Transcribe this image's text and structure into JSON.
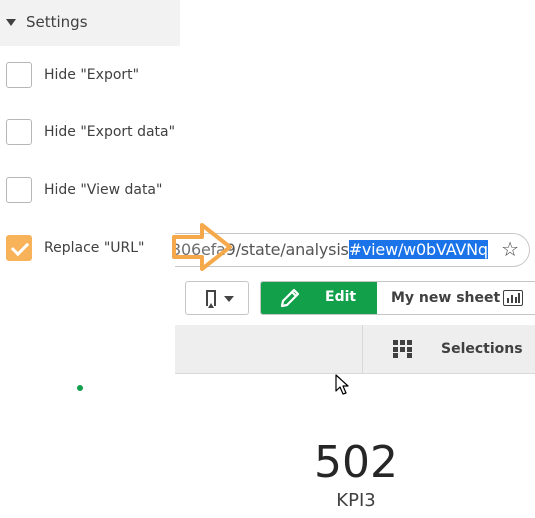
{
  "settings": {
    "title": "Settings",
    "options": [
      {
        "label": "Hide \"Export\"",
        "checked": false
      },
      {
        "label": "Hide \"Export data\"",
        "checked": false
      },
      {
        "label": "Hide \"View data\"",
        "checked": false
      },
      {
        "label": "Replace \"URL\"",
        "checked": true
      }
    ],
    "accent_color": "#f8b25a"
  },
  "address_bar": {
    "url_prefix": "306efa9/state/analysis",
    "url_selected": "#view/w0bVAVNq",
    "selection_color": "#1a73e8",
    "annotation_color": "#f6a94a"
  },
  "toolbar": {
    "edit_label": "Edit",
    "sheet_name": "My new sheet",
    "edit_color": "#12a04a"
  },
  "selections_bar": {
    "label": "Selections"
  },
  "kpi": {
    "value": "502",
    "label": "KPI3"
  }
}
